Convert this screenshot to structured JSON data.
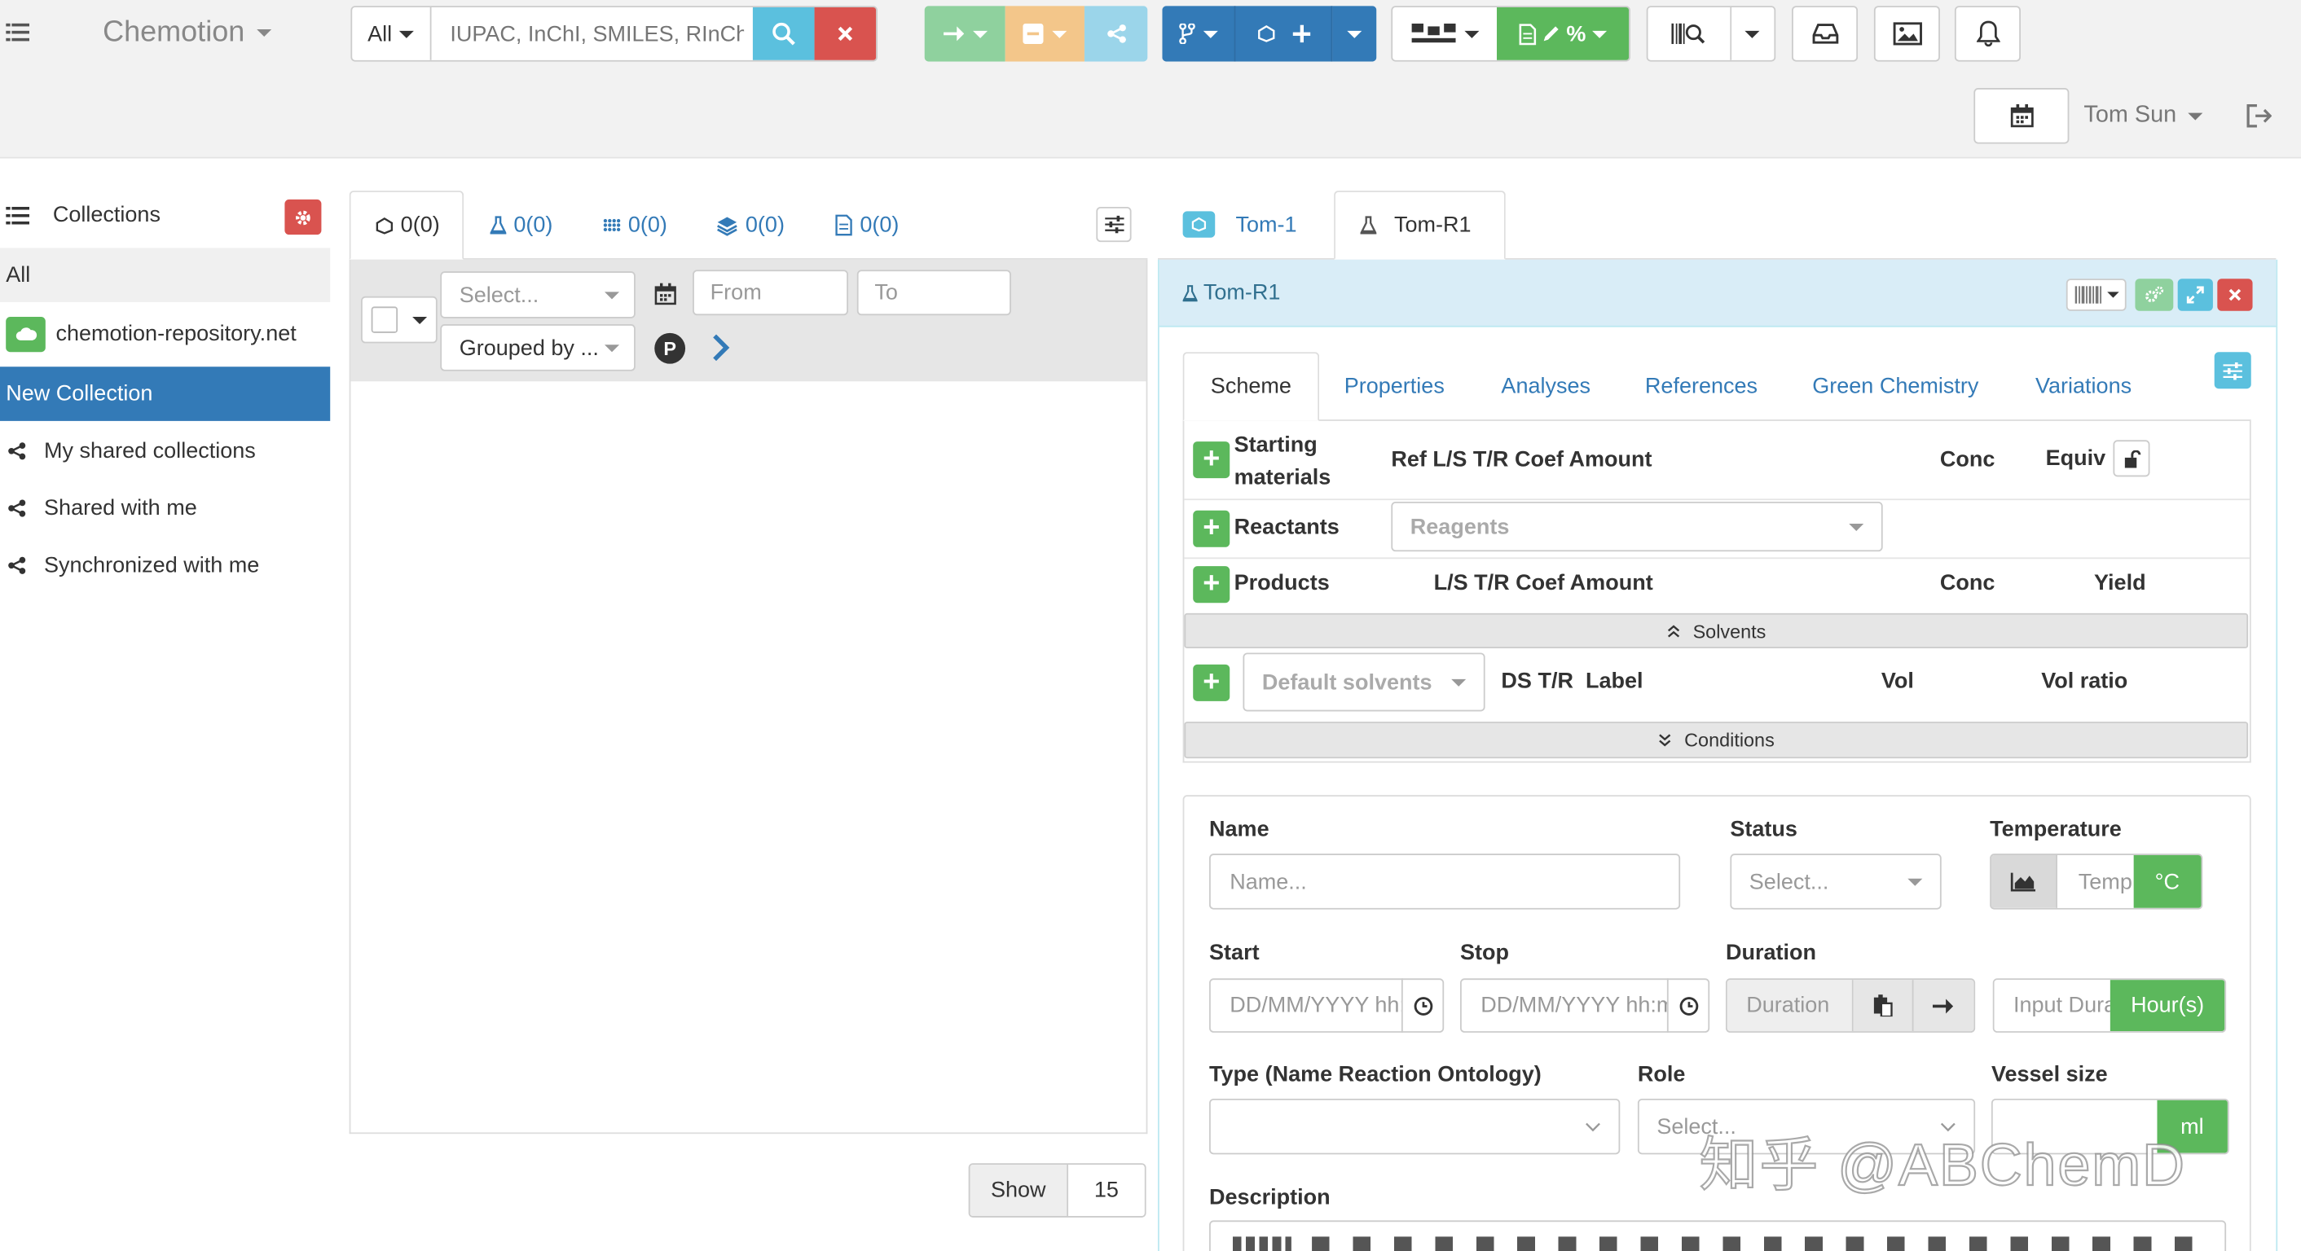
{
  "navbar": {
    "brand": "Chemotion",
    "search_scope": "All",
    "search_placeholder": "IUPAC, InChI, SMILES, RInChI",
    "user": "Tom Sun"
  },
  "sidebar": {
    "title": "Collections",
    "items": [
      "All",
      "chemotion-repository.net",
      "New Collection",
      "My shared collections",
      "Shared with me",
      "Synchronized with me"
    ]
  },
  "list": {
    "tabs": [
      "0(0)",
      "0(0)",
      "0(0)",
      "0(0)",
      "0(0)"
    ],
    "select_placeholder": "Select...",
    "from_placeholder": "From",
    "to_placeholder": "To",
    "grouped_by": "Grouped by ...",
    "p_label": "P",
    "show_label": "Show",
    "show_value": "15"
  },
  "detail": {
    "tabs": [
      "Tom-1",
      "Tom-R1"
    ],
    "title": "Tom-R1",
    "subtabs": [
      "Scheme",
      "Properties",
      "Analyses",
      "References",
      "Green Chemistry",
      "Variations"
    ],
    "scheme": {
      "starting_1": "Starting",
      "starting_2": "materials",
      "starting_cols": "Ref L/S T/R Coef Amount",
      "conc": "Conc",
      "equiv": "Equiv",
      "reactants": "Reactants",
      "reagents_placeholder": "Reagents",
      "products": "Products",
      "products_cols": "L/S T/R Coef Amount",
      "yield": "Yield",
      "solvents": "Solvents",
      "default_solvents": "Default solvents",
      "solvent_cols": "DS T/R  Label",
      "vol": "Vol",
      "vol_ratio": "Vol ratio",
      "conditions": "Conditions"
    },
    "form": {
      "name_label": "Name",
      "name_placeholder": "Name...",
      "status_label": "Status",
      "status_placeholder": "Select...",
      "temperature_label": "Temperature",
      "temperature_placeholder": "Temp",
      "temperature_unit": "°C",
      "start_label": "Start",
      "start_placeholder": "DD/MM/YYYY hh:mm:ss",
      "stop_label": "Stop",
      "stop_placeholder": "DD/MM/YYYY hh:mm:ss",
      "duration_label": "Duration",
      "duration_placeholder": "Duration",
      "duration_input_placeholder": "Input Duration",
      "duration_unit": "Hour(s)",
      "type_label": "Type (Name Reaction Ontology)",
      "role_label": "Role",
      "role_placeholder": "Select...",
      "vessel_label": "Vessel size",
      "vessel_unit": "ml",
      "description_label": "Description"
    }
  },
  "watermark": "知乎 @ABChemD",
  "colors": {
    "primary": "#337ab7",
    "success": "#5cb85c",
    "danger": "#d9534f",
    "info": "#5bc0de",
    "warning": "#f0ad4e"
  }
}
